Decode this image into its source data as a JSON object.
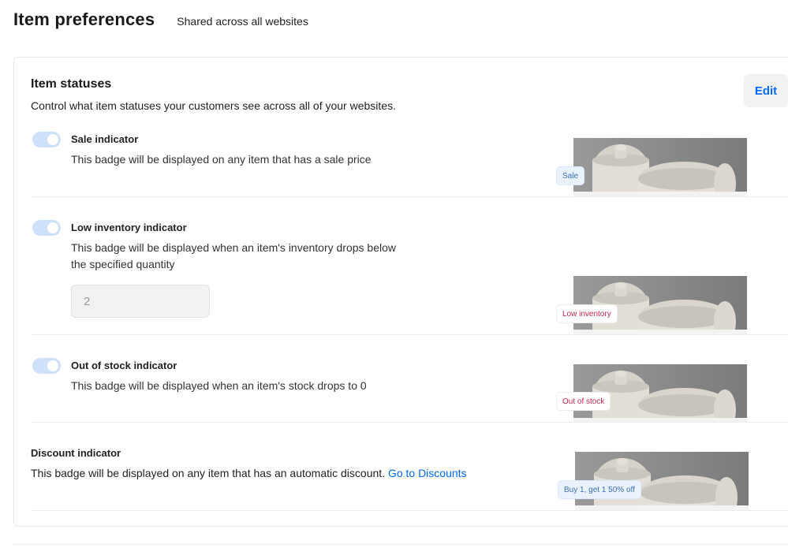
{
  "header": {
    "title": "Item preferences",
    "subtitle": "Shared across all websites"
  },
  "card": {
    "title": "Item statuses",
    "description": "Control what item statuses your customers see across all of your websites.",
    "edit_label": "Edit"
  },
  "indicators": [
    {
      "title": "Sale indicator",
      "description": "This badge will be displayed on any item that has a sale price",
      "enabled": true,
      "badge": "Sale"
    },
    {
      "title": "Low inventory indicator",
      "description_line1": "This badge will be displayed when an item's inventory drops below",
      "description_line2": "the specified quantity",
      "quantity": "2",
      "enabled": true,
      "badge": "Low inventory"
    },
    {
      "title": "Out of stock indicator",
      "description": "This badge will be displayed when an item's stock drops to 0",
      "enabled": true,
      "badge": "Out of stock"
    },
    {
      "title": "Discount indicator",
      "description": "This badge will be displayed on any item that has an automatic discount.",
      "link": "Go to Discounts",
      "badge": "Buy 1, get 1 50% off"
    }
  ],
  "colors": {
    "accent": "#006aff",
    "toggle_on": "#cfe0fa",
    "badge_red": "#c0294d",
    "badge_blue": "#3d6fb9"
  },
  "icons": [
    "product-preview-image"
  ]
}
